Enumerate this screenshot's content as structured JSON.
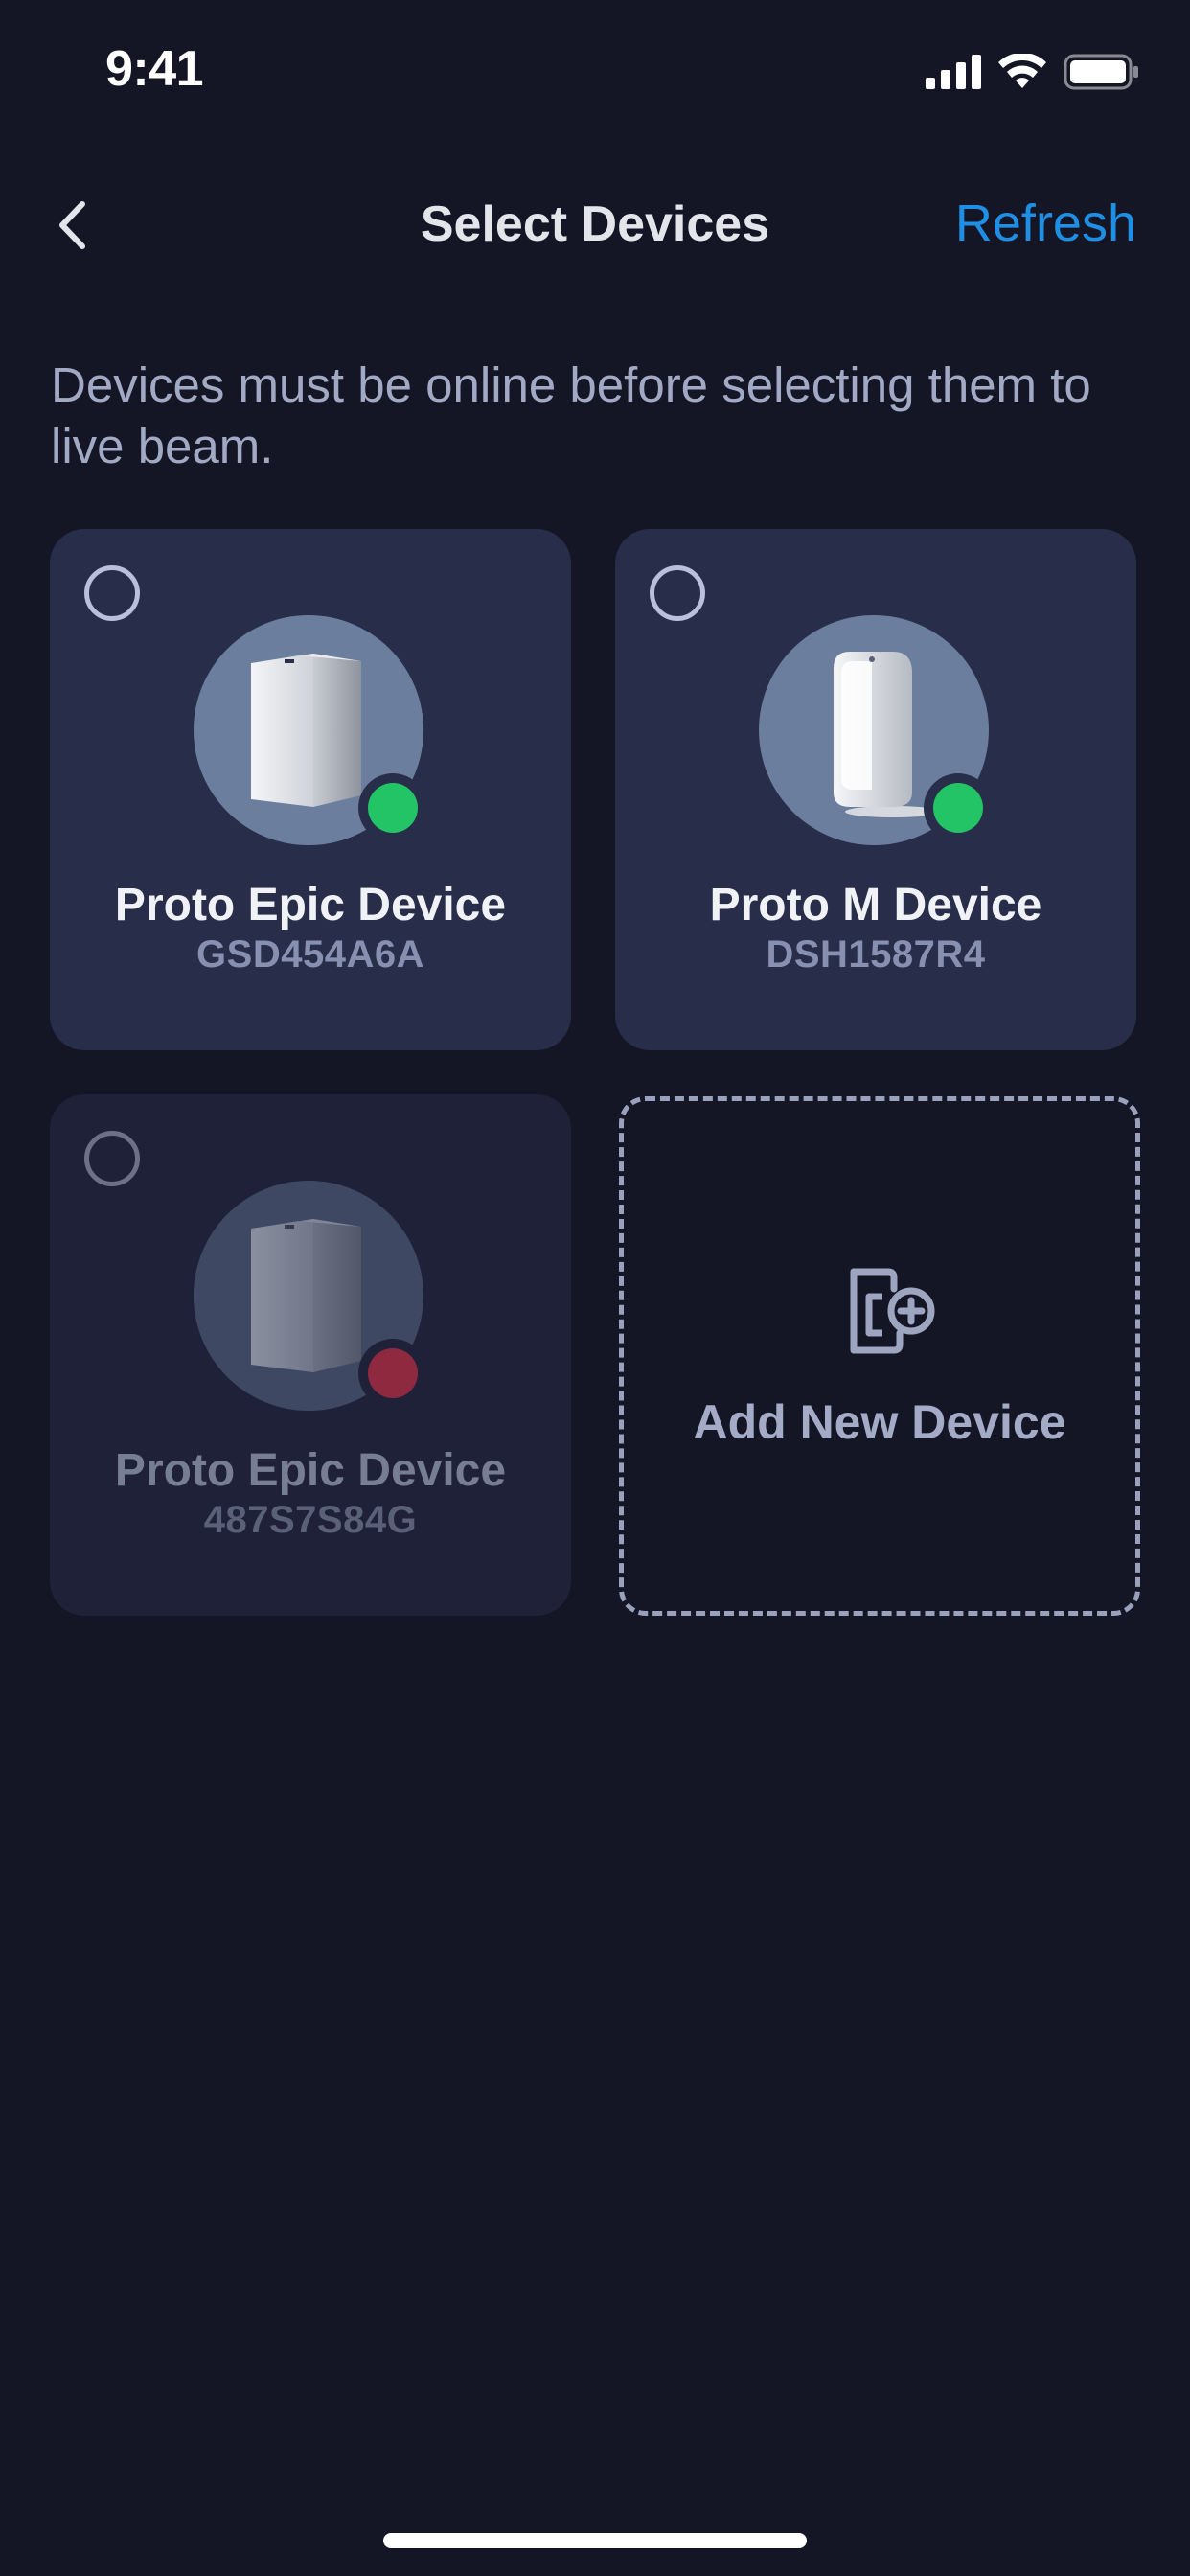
{
  "status_bar": {
    "time": "9:41"
  },
  "nav": {
    "title": "Select Devices",
    "refresh_label": "Refresh",
    "back_icon": "chevron-left-icon"
  },
  "instruction": "Devices must be online before selecting them to live beam.",
  "devices": [
    {
      "name": "Proto Epic Device",
      "serial": "GSD454A6A",
      "status": "online",
      "status_color": "#22C466",
      "selected": false
    },
    {
      "name": "Proto M Device",
      "serial": "DSH1587R4",
      "status": "online",
      "status_color": "#22C466",
      "selected": false
    },
    {
      "name": "Proto Epic Device",
      "serial": "487S7S84G",
      "status": "offline",
      "status_color": "#8E2940",
      "selected": false
    }
  ],
  "add_device": {
    "label": "Add New Device",
    "icon": "add-device-icon"
  },
  "colors": {
    "background": "#141625",
    "card": "#282D4A",
    "accent": "#1F8FE6"
  }
}
